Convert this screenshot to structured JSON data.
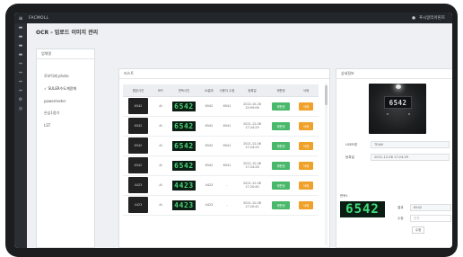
{
  "app": {
    "brand": "FACMOLL",
    "user_label": "푸시알리아핀즈"
  },
  "page": {
    "title": "OCR - 업로드 이미지 관리"
  },
  "groups": {
    "header": "업체명",
    "items": [
      {
        "label": "로보틱제 photo"
      },
      {
        "label": "✓ SULER수도계량계"
      },
      {
        "label": "powermeter"
      },
      {
        "label": "온습1첨기"
      },
      {
        "label": "LST"
      }
    ]
  },
  "list": {
    "header": "리스트",
    "columns": [
      "원본사진",
      "모드",
      "판독사진",
      "AI결과",
      "사용자 수정",
      "등록일",
      "재판정",
      "삭제"
    ],
    "rows": [
      {
        "thumb": "6542",
        "mode": "AI",
        "reading": "6542",
        "ai": "6542",
        "user": "6541",
        "date": "2022-10-28",
        "time": "15:59:06",
        "rejudge": "재판정",
        "delete": "삭제"
      },
      {
        "thumb": "6542",
        "mode": "AI",
        "reading": "6542",
        "ai": "6542",
        "user": "6541",
        "date": "2021-12-08",
        "time": "17:24:29",
        "rejudge": "재판정",
        "delete": "삭제"
      },
      {
        "thumb": "6542",
        "mode": "AI",
        "reading": "6542",
        "ai": "6542",
        "user": "6541",
        "date": "2021-12-08",
        "time": "17:24:29",
        "rejudge": "재판정",
        "delete": "삭제"
      },
      {
        "thumb": "6542",
        "mode": "AI",
        "reading": "6542",
        "ai": "6542",
        "user": "6541",
        "date": "2021-12-08",
        "time": "17:24:28",
        "rejudge": "재판정",
        "delete": "삭제"
      },
      {
        "thumb": "4423",
        "mode": "AI",
        "reading": "4423",
        "ai": "4423",
        "user": "-",
        "date": "2021-12-08",
        "time": "17:20:40",
        "rejudge": "재판정",
        "delete": "삭제"
      },
      {
        "thumb": "4423",
        "mode": "AI",
        "reading": "4423",
        "ai": "4423",
        "user": "-",
        "date": "2021-12-08",
        "time": "17:20:41",
        "rejudge": "재판정",
        "delete": "삭제"
      }
    ]
  },
  "detail": {
    "header": "상세정보",
    "photo_value": "6542",
    "user_label": "USER명",
    "user_value": "TEAM",
    "date_label": "등록일",
    "date_value": "2021-12-08 17:24:29",
    "reading_label": "판독1",
    "reading_value": "6542",
    "result_label": "결과",
    "result_value": "6542",
    "edit_label": "수정",
    "edit_placeholder": "숫자",
    "save_label": "수정"
  },
  "colors": {
    "topbar": "#23262b",
    "green": "#49b86b",
    "orange": "#f0a12a",
    "segment_green": "#3fe07c"
  }
}
